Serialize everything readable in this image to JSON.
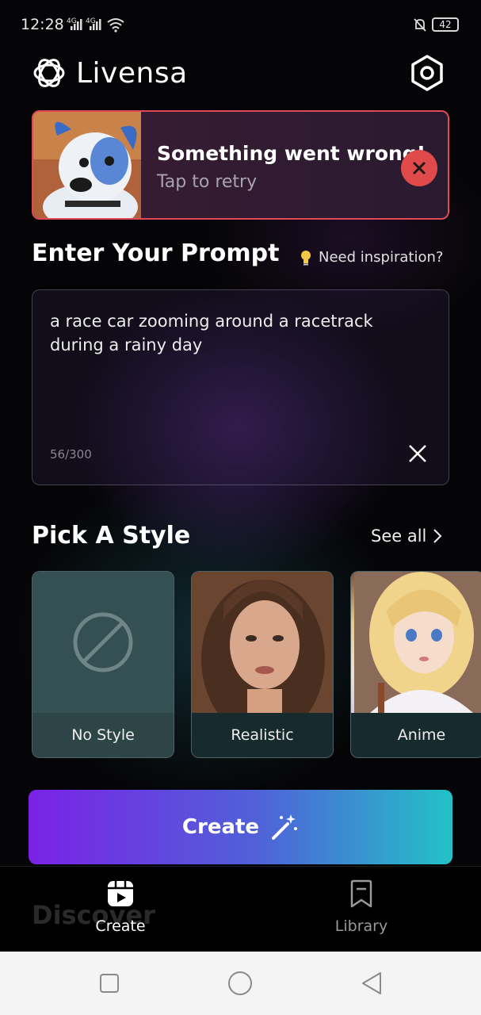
{
  "status_bar": {
    "time": "12:28",
    "network_1": "4G",
    "network_2": "4G",
    "battery": "42",
    "icons": [
      "signal-icon",
      "signal-icon",
      "wifi-icon",
      "bell-off-icon",
      "battery-icon"
    ]
  },
  "header": {
    "app_name": "Livensa",
    "logo_icon": "livensa-logo-icon",
    "settings_icon": "hexagon-settings-icon"
  },
  "error_banner": {
    "title": "Something went wrong!",
    "subtitle": "Tap to retry",
    "accent": "#e04a4a"
  },
  "prompt": {
    "heading": "Enter Your Prompt",
    "inspiration_label": "Need inspiration?",
    "inspiration_icon": "lightbulb-icon",
    "text": "a race car zooming around a racetrack during a rainy day",
    "char_count": "56/300"
  },
  "styles": {
    "heading": "Pick A Style",
    "see_all": "See all",
    "items": [
      {
        "label": "No Style",
        "icon": "no-style-icon"
      },
      {
        "label": "Realistic"
      },
      {
        "label": "Anime"
      }
    ]
  },
  "create_button": {
    "label": "Create",
    "icon": "magic-wand-icon"
  },
  "bottom_nav": {
    "ghost_text": "Discover",
    "items": [
      {
        "label": "Create",
        "icon": "create-icon",
        "active": true
      },
      {
        "label": "Library",
        "icon": "bookmark-icon",
        "active": false
      }
    ]
  },
  "colors": {
    "gradient_start": "#7a22e6",
    "gradient_end": "#22c2c6",
    "error_border": "#e04a56"
  }
}
